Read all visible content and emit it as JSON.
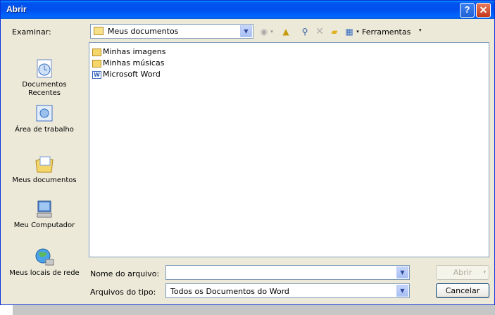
{
  "window": {
    "title": "Abrir",
    "help_label": "?",
    "close_label": "✕"
  },
  "lookin": {
    "label": "Examinar:",
    "value": "Meus documentos"
  },
  "toolbar": {
    "tools_label": "Ferramentas"
  },
  "places": [
    {
      "label": "Documentos Recentes",
      "icon": "recent-documents-icon"
    },
    {
      "label": "Área de trabalho",
      "icon": "desktop-icon"
    },
    {
      "label": "Meus documentos",
      "icon": "my-documents-icon"
    },
    {
      "label": "Meu Computador",
      "icon": "my-computer-icon"
    },
    {
      "label": "Meus locais de rede",
      "icon": "network-places-icon"
    }
  ],
  "files": [
    {
      "name": "Minhas imagens",
      "type": "folder"
    },
    {
      "name": "Minhas músicas",
      "type": "folder"
    },
    {
      "name": "Microsoft Word",
      "type": "word"
    }
  ],
  "filename": {
    "label": "Nome do arquivo:",
    "value": ""
  },
  "filetype": {
    "label": "Arquivos do tipo:",
    "value": "Todos os Documentos do Word"
  },
  "buttons": {
    "open": "Abrir",
    "cancel": "Cancelar"
  },
  "colors": {
    "titlebar": "#0054e3",
    "dialog": "#ece9d8",
    "border": "#7f9db9"
  }
}
